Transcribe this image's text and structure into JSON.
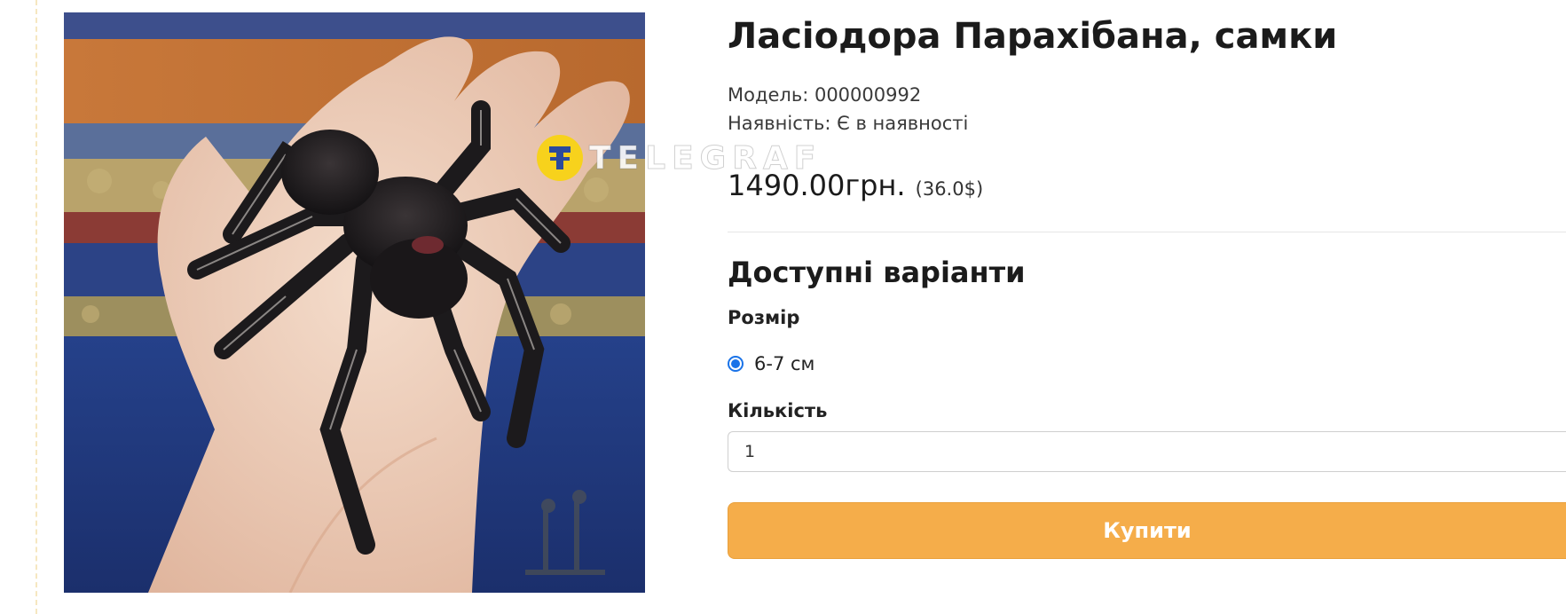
{
  "product": {
    "title": "Ласіодора Парахібана, самки",
    "model": "Модель: 000000992",
    "availability": "Наявність: Є в наявності",
    "price": "1490.00грн.",
    "price_usd": "(36.0$)"
  },
  "variants": {
    "heading": "Доступні варіанти",
    "size_label": "Розмір",
    "size_option": "6-7 см",
    "size_selected": true,
    "quantity_label": "Кількість",
    "quantity_value": "1"
  },
  "buy_button": {
    "label": "Купити",
    "color": "#f5ad4a"
  },
  "watermark": {
    "text": "TELEGRAF",
    "logo_color": "#f7d21c"
  },
  "photo": {
    "icon": "tarantula-photo"
  }
}
